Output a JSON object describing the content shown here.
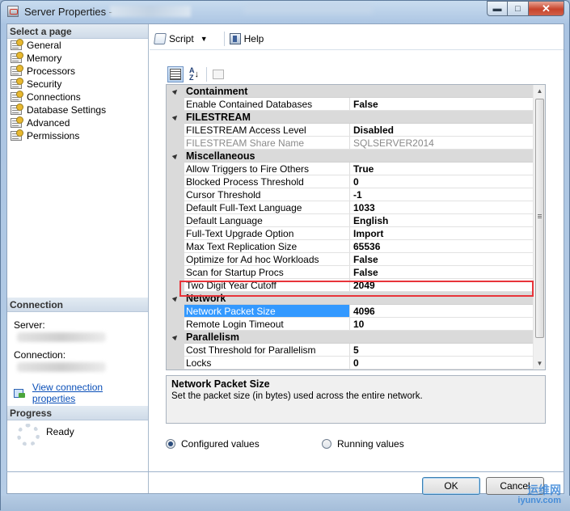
{
  "window": {
    "title": "Server Properties -"
  },
  "left": {
    "select_page_header": "Select a page",
    "pages": [
      "General",
      "Memory",
      "Processors",
      "Security",
      "Connections",
      "Database Settings",
      "Advanced",
      "Permissions"
    ],
    "connection_header": "Connection",
    "server_label": "Server:",
    "connection_label": "Connection:",
    "view_link": "View connection properties",
    "progress_header": "Progress",
    "progress_status": "Ready"
  },
  "toolbar": {
    "script_label": "Script",
    "help_label": "Help"
  },
  "grid": {
    "rows": [
      {
        "type": "cat",
        "name": "Containment"
      },
      {
        "type": "prop",
        "name": "Enable Contained Databases",
        "value": "False"
      },
      {
        "type": "cat",
        "name": "FILESTREAM"
      },
      {
        "type": "prop",
        "name": "FILESTREAM Access Level",
        "value": "Disabled"
      },
      {
        "type": "prop",
        "name": "FILESTREAM Share Name",
        "value": "SQLSERVER2014",
        "readonly": true
      },
      {
        "type": "cat",
        "name": "Miscellaneous"
      },
      {
        "type": "prop",
        "name": "Allow Triggers to Fire Others",
        "value": "True"
      },
      {
        "type": "prop",
        "name": "Blocked Process Threshold",
        "value": "0"
      },
      {
        "type": "prop",
        "name": "Cursor Threshold",
        "value": "-1"
      },
      {
        "type": "prop",
        "name": "Default Full-Text Language",
        "value": "1033"
      },
      {
        "type": "prop",
        "name": "Default Language",
        "value": "English"
      },
      {
        "type": "prop",
        "name": "Full-Text Upgrade Option",
        "value": "Import"
      },
      {
        "type": "prop",
        "name": "Max Text Replication Size",
        "value": "65536"
      },
      {
        "type": "prop",
        "name": "Optimize for Ad hoc Workloads",
        "value": "False"
      },
      {
        "type": "prop",
        "name": "Scan for Startup Procs",
        "value": "False"
      },
      {
        "type": "prop",
        "name": "Two Digit Year Cutoff",
        "value": "2049"
      },
      {
        "type": "cat",
        "name": "Network"
      },
      {
        "type": "prop",
        "name": "Network Packet Size",
        "value": "4096",
        "selected": true
      },
      {
        "type": "prop",
        "name": "Remote Login Timeout",
        "value": "10"
      },
      {
        "type": "cat",
        "name": "Parallelism"
      },
      {
        "type": "prop",
        "name": "Cost Threshold for Parallelism",
        "value": "5"
      },
      {
        "type": "prop",
        "name": "Locks",
        "value": "0"
      }
    ]
  },
  "description": {
    "title": "Network Packet Size",
    "text": "Set the packet size (in bytes) used across the entire network."
  },
  "options": {
    "configured": "Configured values",
    "running": "Running values",
    "selected": "configured"
  },
  "buttons": {
    "ok": "OK",
    "cancel": "Cancel"
  },
  "watermark": {
    "line1": "运维网",
    "line2": "iyunv.com"
  },
  "colors": {
    "selection": "#3399ff",
    "highlight_box": "#e8343a",
    "link": "#0a4fb8"
  }
}
